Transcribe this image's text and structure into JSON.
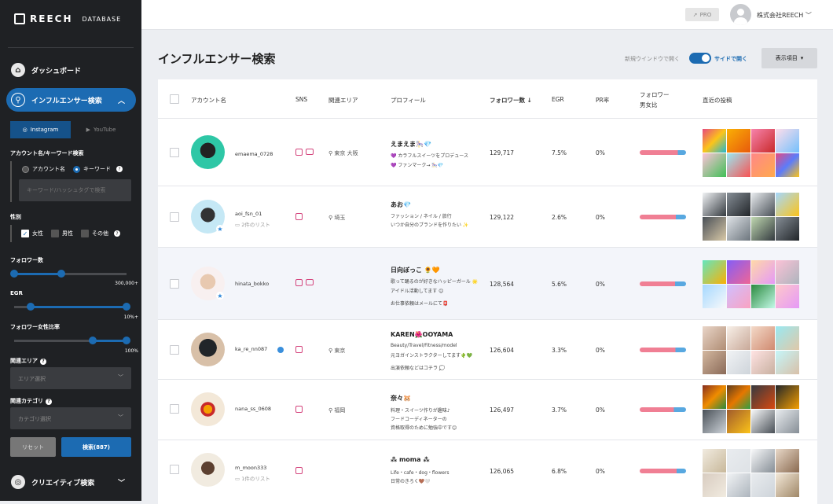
{
  "sidebar": {
    "brand": "REECH",
    "brand_sub": "DATABASE",
    "nav_dashboard": "ダッシュボード",
    "nav_search": "インフルエンサー検索",
    "tab_instagram": "Instagram",
    "tab_youtube": "YouTube",
    "label_keyword": "アカウント名/キーワード検索",
    "radio_account": "アカウント名",
    "radio_keyword": "キーワード",
    "keyword_placeholder": "キーワード/ハッシュタグで検索",
    "label_gender": "性別",
    "gender_female": "女性",
    "gender_male": "男性",
    "gender_other": "その他",
    "label_followers": "フォロワー数",
    "followers_max": "300,000+",
    "label_egr": "EGR",
    "egr_max": "10%+",
    "label_female_ratio": "フォロワー女性比率",
    "female_ratio_max": "100%",
    "label_area": "関連エリア",
    "area_placeholder": "エリア選択",
    "label_category": "関連カテゴリ",
    "category_placeholder": "カテゴリ選択",
    "reset": "リセット",
    "search": "検索(887)",
    "nav_creative": "クリエイティブ検索",
    "slider_followers": [
      0,
      0.42
    ],
    "slider_egr": [
      0.15,
      1.0
    ],
    "slider_female": [
      0.7,
      1.0
    ]
  },
  "header": {
    "pro": "PRO",
    "company": "株式会社REECH"
  },
  "page": {
    "title": "インフルエンサー検索",
    "new_window": "新規ウインドウで開く",
    "side_open": "サイドで開く",
    "display": "表示項目"
  },
  "columns": {
    "account": "アカウント名",
    "sns": "SNS",
    "area": "関連エリア",
    "profile": "プロフィール",
    "followers": "フォロワー数",
    "egr": "EGR",
    "pr": "PR率",
    "gender1": "フォロワー",
    "gender2": "男女比",
    "recent": "直近の投稿"
  },
  "rows": [
    {
      "account": "emaema_0728",
      "list": "",
      "area": "東京 大阪",
      "name": "えまえま🎠💎",
      "p1": "💜 カラフルスイーツをプロデュース",
      "p2": "💜 ファンマーク→ 🎠💎",
      "p3": "",
      "followers": "129,717",
      "egr": "7.5%",
      "pr": "0%",
      "female_ratio": 0.82
    },
    {
      "account": "aoi_fsn_01",
      "list": "2件のリスト",
      "area": "埼玉",
      "name": "あお💎",
      "p1": "ファッション / ネイル / 旅行",
      "p2": "いつか自分のブランドを作りたい ✨",
      "p3": "",
      "followers": "129,122",
      "egr": "2.6%",
      "pr": "0%",
      "female_ratio": 0.78
    },
    {
      "account": "hinata_bokko",
      "list": "",
      "area": "",
      "name": "日向ぼっこ 🌻🧡",
      "p1": "歌って踊るのが好きなハッピーガール 🌟",
      "p2": "アイドル活動してます 😊",
      "p3": "お仕事依頼はメールにて📮",
      "followers": "128,564",
      "egr": "5.6%",
      "pr": "0%",
      "female_ratio": 0.76
    },
    {
      "account": "ka_re_nn087",
      "list": "",
      "area": "東京",
      "name": "KAREN🌺OOYAMA",
      "p1": "Beauty/Travel/Fitness/model",
      "p2": "元ヨガインストラクターしてます🌵💚",
      "p3": "出演依頼などはコチラ 💭",
      "followers": "126,604",
      "egr": "3.3%",
      "pr": "0%",
      "female_ratio": 0.77
    },
    {
      "account": "nana_ss_0608",
      "list": "",
      "area": "福岡",
      "name": "奈々🐹",
      "p1": "料理・スイーツ作りが趣味♪",
      "p2": "フードコーディネーターの",
      "p3": "資格取得のために勉強中です😊",
      "followers": "126,497",
      "egr": "3.7%",
      "pr": "0%",
      "female_ratio": 0.74
    },
    {
      "account": "m_moon333",
      "list": "1件のリスト",
      "area": "",
      "name": "⁂ moma ⁂",
      "p1": "Life・cafe・dog・flowers",
      "p2": "日常のきろく🤎🤍",
      "p3": "",
      "followers": "126,065",
      "egr": "6.8%",
      "pr": "0%",
      "female_ratio": 0.8
    }
  ],
  "colors": {
    "accent": "#1c6bb2",
    "sidebar": "#1f2124",
    "female": "#f07f94",
    "male": "#58a8e0"
  }
}
